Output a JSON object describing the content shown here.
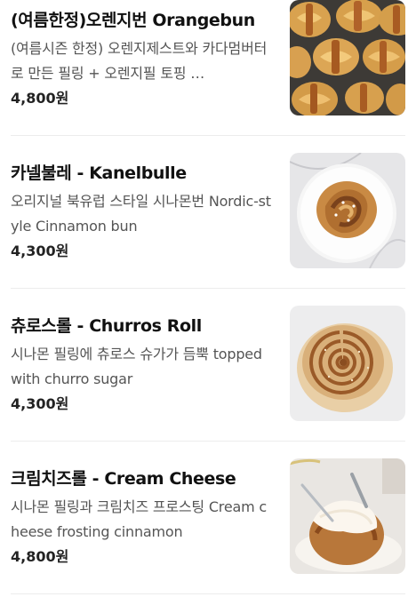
{
  "menu": {
    "items": [
      {
        "name": "(여름한정)오렌지번 Orangebun",
        "description": "(여름시즌 한정) 오렌지제스트와 카다멈버터로 만든 필링 + 오렌지필 토핑 …",
        "price": "4,800원",
        "image": "orange-bun-tray-photo"
      },
      {
        "name": "카넬불레 - Kanelbulle",
        "description": "오리지널 북유럽 스타일 시나몬번 Nordic-style Cinnamon bun",
        "price": "4,300원",
        "image": "kanelbulle-plate-photo"
      },
      {
        "name": "츄로스롤 - Churros Roll",
        "description": "시나몬 필링에 츄로스 슈가가 듬뿍 topped with churro sugar",
        "price": "4,300원",
        "image": "churros-roll-photo"
      },
      {
        "name": "크림치즈롤 - Cream Cheese",
        "description": "시나몬 필링과 크림치즈 프로스팅 Cream cheese frosting cinnamon",
        "price": "4,800원",
        "image": "cream-cheese-roll-photo"
      }
    ]
  }
}
